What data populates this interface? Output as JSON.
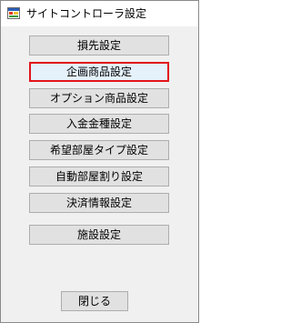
{
  "window": {
    "title": "サイトコントローラ設定",
    "app_icon": "winforms-app-icon"
  },
  "menu": {
    "items": [
      {
        "label": "損先設定"
      },
      {
        "label": "企画商品設定",
        "focused": true
      },
      {
        "label": "オプション商品設定"
      },
      {
        "label": "入金金種設定"
      },
      {
        "label": "希望部屋タイプ設定"
      },
      {
        "label": "自動部屋割り設定"
      },
      {
        "label": "決済情報設定"
      },
      {
        "label": "施設設定"
      }
    ]
  },
  "footer": {
    "close_label": "閉じる"
  },
  "colors": {
    "focus_border": "#e0151a",
    "button_face": "#e1e1e1",
    "window_bg": "#f0f0f0"
  }
}
